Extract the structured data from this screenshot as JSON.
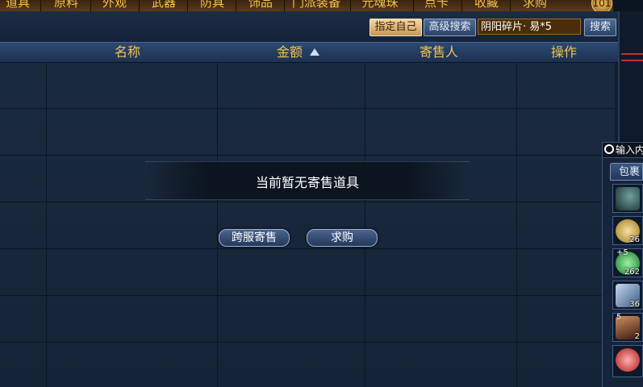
{
  "tabs": [
    "道具",
    "原料",
    "外观",
    "武器",
    "防具",
    "饰品",
    "门派装备",
    "元魂珠",
    "点卡",
    "收藏",
    "求购"
  ],
  "logo": "101",
  "search": {
    "specify_self": "指定自己",
    "advanced": "高级搜索",
    "query": "阴阳碎片· 易*5",
    "button": "搜索"
  },
  "columns": {
    "name": "名称",
    "price": "金额",
    "seller": "寄售人",
    "action": "操作"
  },
  "empty": {
    "message": "当前暂无寄售道具",
    "cross_server": "跨服寄售",
    "want_buy": "求购"
  },
  "inventory": {
    "search_placeholder": "输入内",
    "tab": "包裹",
    "items": [
      {
        "icon": "dark-crystal-icon",
        "qty": "",
        "level": "",
        "color": "#2a4a4a"
      },
      {
        "icon": "golden-orb-icon",
        "qty": "26",
        "level": "",
        "color": "#c8a040"
      },
      {
        "icon": "green-orb-icon",
        "qty": "262",
        "level": "+5",
        "color": "#2aa040"
      },
      {
        "icon": "scroll-icon",
        "qty": "36",
        "level": "",
        "color": "#5a7aa0"
      },
      {
        "icon": "armor-icon",
        "qty": "2",
        "level": "5",
        "color": "#6a3a20"
      },
      {
        "icon": "red-orb-icon",
        "qty": "",
        "level": "",
        "color": "#d03030"
      }
    ]
  }
}
